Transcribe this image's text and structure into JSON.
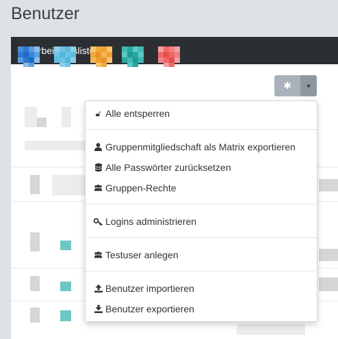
{
  "page": {
    "title": "Benutzer"
  },
  "panel": {
    "title": "Bearbeitungsliste"
  },
  "toolbar": {
    "settings_icon": "gear-icon",
    "dropdown_icon": "caret-down-icon"
  },
  "menu": {
    "items": [
      {
        "label": "Alle entsperren",
        "icon": "unlock-icon"
      },
      {
        "label": "Gruppenmitgliedschaft als Matrix exportieren",
        "icon": "user-icon"
      },
      {
        "label": "Alle Passwörter zurücksetzen",
        "icon": "database-icon"
      },
      {
        "label": "Gruppen-Rechte",
        "icon": "users-icon"
      },
      {
        "label": "Logins administrieren",
        "icon": "key-icon"
      },
      {
        "label": "Testuser anlegen",
        "icon": "users-icon"
      },
      {
        "label": "Benutzer importieren",
        "icon": "upload-icon"
      },
      {
        "label": "Benutzer exportieren",
        "icon": "download-icon"
      }
    ]
  }
}
